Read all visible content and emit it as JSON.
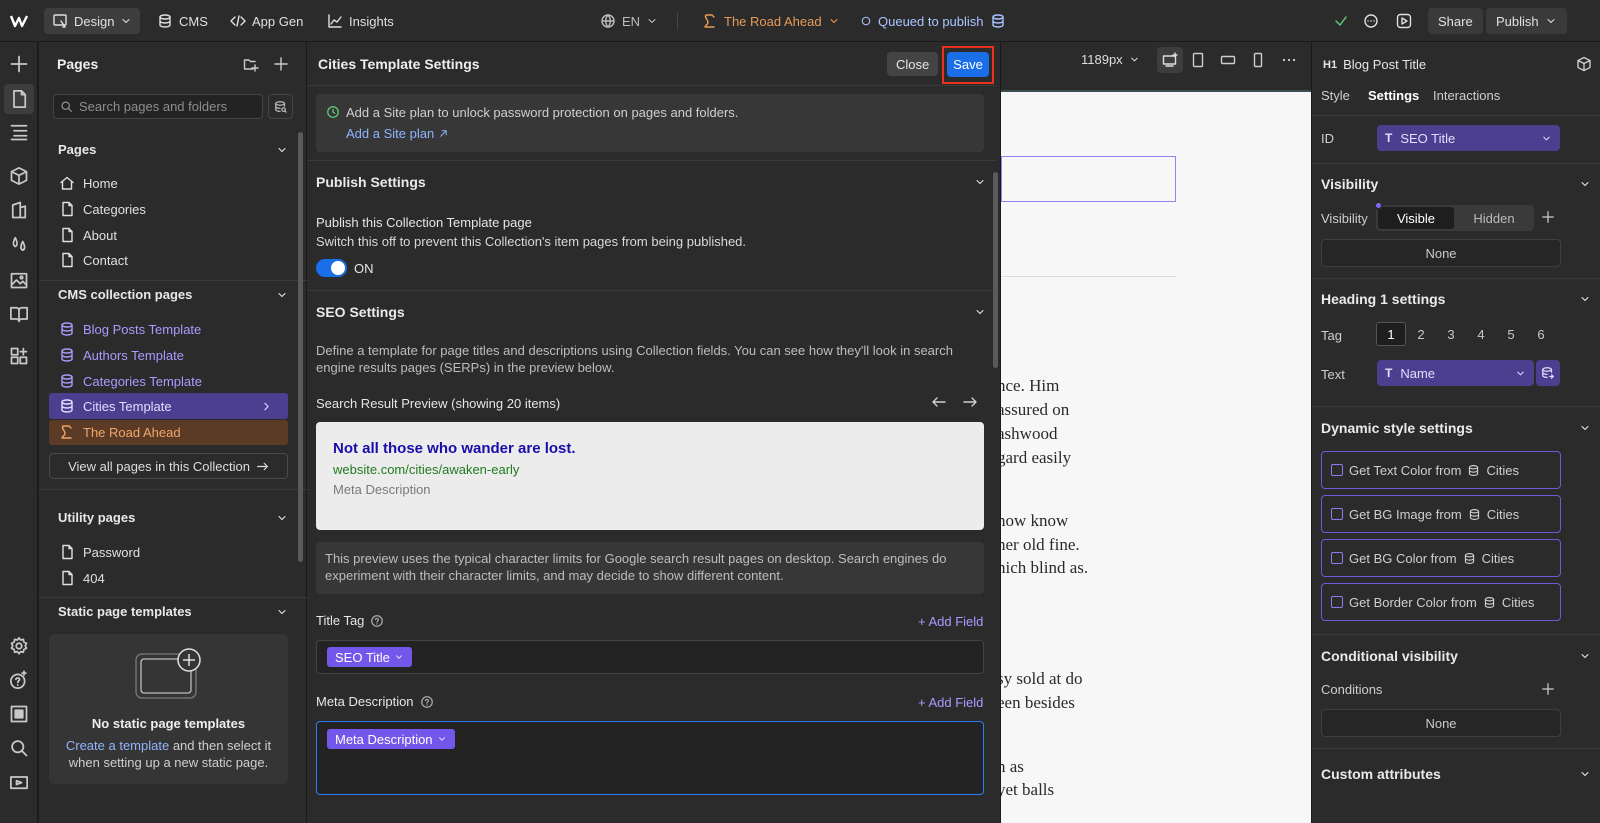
{
  "topbar": {
    "design_label": "Design",
    "cms_label": "CMS",
    "appgen_label": "App Gen",
    "insights_label": "Insights",
    "locale": "EN",
    "page_name": "The Road Ahead",
    "status": "Queued to publish",
    "share_label": "Share",
    "publish_label": "Publish"
  },
  "pages_panel": {
    "title": "Pages",
    "search_placeholder": "Search pages and folders",
    "pages_section": "Pages",
    "pages": [
      "Home",
      "Categories",
      "About",
      "Contact"
    ],
    "cms_section": "CMS collection pages",
    "cms_pages": [
      "Blog Posts Template",
      "Authors Template",
      "Categories Template",
      "Cities Template",
      "The Road Ahead"
    ],
    "view_all_label": "View all pages in this Collection",
    "utility_section": "Utility pages",
    "utility_pages": [
      "Password",
      "404"
    ],
    "static_section": "Static page templates",
    "static_empty_title": "No static page templates",
    "static_empty_link": "Create a template",
    "static_empty_text": "and then select it when setting up a new static page."
  },
  "settings_panel": {
    "title": "Cities Template Settings",
    "close_label": "Close",
    "save_label": "Save",
    "siteplan_text": "Add a Site plan to unlock password protection on pages and folders.",
    "siteplan_link": "Add a Site plan",
    "publish_section": "Publish Settings",
    "publish_title": "Publish this Collection Template page",
    "publish_desc": "Switch this off to prevent this Collection's item pages from being published.",
    "publish_toggle": "ON",
    "seo_section": "SEO Settings",
    "seo_desc_1": "Define a template for page titles and descriptions using Collection fields. You can see how they'll look in search",
    "seo_desc_2": "engine results pages (SERPs) in the preview below.",
    "preview_label": "Search Result Preview (showing 20 items)",
    "preview_title": "Not all those who wander are lost.",
    "preview_url": "website.com/cities/awaken-early",
    "preview_meta": "Meta Description",
    "preview_note_1": "This preview uses the typical character limits for Google search result pages on desktop. Search engines do",
    "preview_note_2": "experiment with their character limits, and may decide to show different content.",
    "title_tag_label": "Title Tag",
    "title_tag_pill": "SEO Title",
    "meta_label": "Meta Description",
    "meta_pill": "Meta Description",
    "add_field_label": "+ Add Field"
  },
  "canvas": {
    "width_label": "1189px",
    "lines": [
      "nce. Him",
      "assured on",
      "ashwood",
      "gard easily",
      "how know",
      "her old fine.",
      "hich blind as.",
      "sy sold at do",
      "een besides",
      "n as",
      "yet balls"
    ]
  },
  "right_panel": {
    "element_tag": "H1",
    "element_name": "Blog Post Title",
    "tabs": [
      "Style",
      "Settings",
      "Interactions"
    ],
    "id_label": "ID",
    "id_value": "SEO Title",
    "visibility_section": "Visibility",
    "visibility_label": "Visibility",
    "visible_label": "Visible",
    "hidden_label": "Hidden",
    "none_label": "None",
    "heading_section": "Heading 1 settings",
    "tag_label": "Tag",
    "tags": [
      "1",
      "2",
      "3",
      "4",
      "5",
      "6"
    ],
    "text_label": "Text",
    "text_value": "Name",
    "dynamic_section": "Dynamic style settings",
    "dynamic_rows": [
      "Get Text Color from",
      "Get BG Image from",
      "Get BG Color from",
      "Get Border Color from"
    ],
    "dynamic_source": "Cities",
    "conditional_section": "Conditional visibility",
    "conditions_label": "Conditions",
    "custom_section": "Custom attributes"
  },
  "colors": {
    "accent": "#7357ea",
    "save_blue": "#1a6ee8",
    "orange": "#e89a57",
    "highlight_red": "#e8321e"
  }
}
